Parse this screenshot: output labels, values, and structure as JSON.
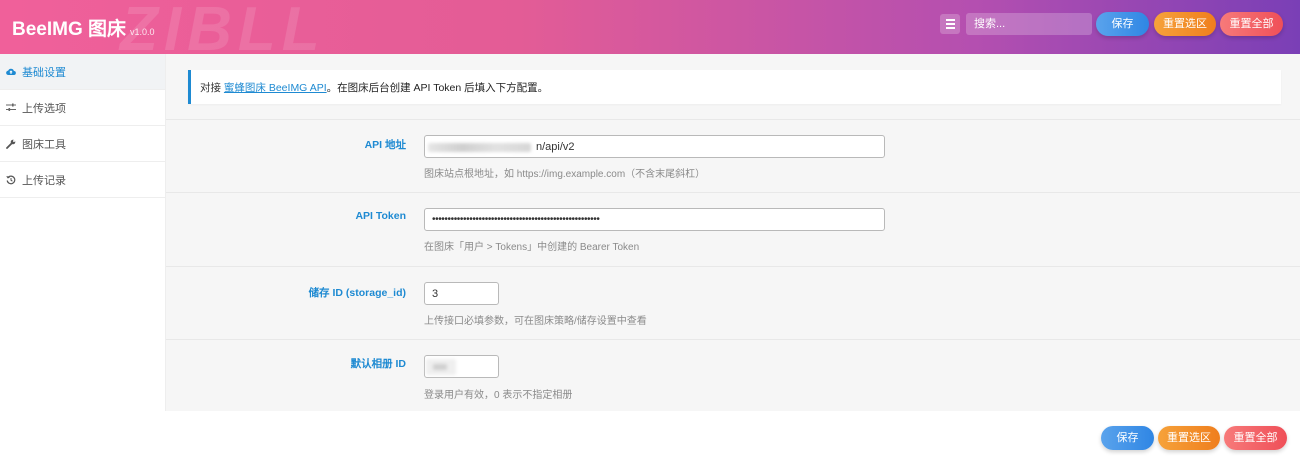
{
  "header": {
    "brand": "BeeIMG 图床",
    "version": "v1.0.0",
    "watermark": "ZIBLL",
    "search_placeholder": "搜索...",
    "save_label": "保存",
    "reset_section_label": "重置选区",
    "reset_all_label": "重置全部"
  },
  "sidebar": {
    "items": [
      {
        "label": "基础设置",
        "icon": "cloud-upload-icon",
        "active": true
      },
      {
        "label": "上传选项",
        "icon": "sliders-icon",
        "active": false
      },
      {
        "label": "图床工具",
        "icon": "wrench-icon",
        "active": false
      },
      {
        "label": "上传记录",
        "icon": "history-icon",
        "active": false
      }
    ]
  },
  "notice": {
    "prefix": "对接 ",
    "link_text": "蜜蜂图床 BeeIMG API",
    "suffix": "。在图床后台创建 API Token 后填入下方配置。"
  },
  "fields": [
    {
      "label": "API 地址",
      "value": "n/api/v2",
      "desc": "图床站点根地址，如 https://img.example.com（不含末尾斜杠）"
    },
    {
      "label": "API Token",
      "value": "••••••••••••••••••••••••••••••••••••••••••••••••••••••",
      "desc": "在图床「用户 > Tokens」中创建的 Bearer Token"
    },
    {
      "label": "储存 ID (storage_id)",
      "value": "3",
      "desc": "上传接口必填参数，可在图床策略/储存设置中查看"
    },
    {
      "label": "默认相册 ID",
      "value": "",
      "desc": "登录用户有效，0 表示不指定相册"
    }
  ],
  "footer": {
    "save_label": "保存",
    "reset_section_label": "重置选区",
    "reset_all_label": "重置全部"
  },
  "colors": {
    "accent": "#1e8ad2",
    "save": "#3a8ee6",
    "reset_section": "#f2902a",
    "reset_all": "#f2606a"
  }
}
